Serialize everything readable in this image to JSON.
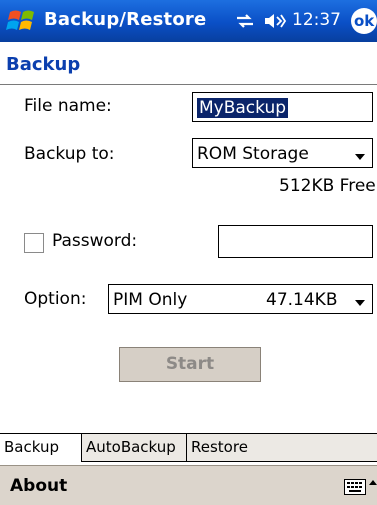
{
  "titlebar": {
    "app_title": "Backup/Restore",
    "clock": "12:37",
    "ok_label": "ok"
  },
  "section_heading": "Backup",
  "form": {
    "file_name_label": "File name:",
    "file_name_value": "MyBackup",
    "backup_to_label": "Backup to:",
    "backup_to_value": "ROM Storage",
    "free_space": "512KB Free",
    "password_label": "Password:",
    "password_value": "",
    "option_label": "Option:",
    "option_value": "PIM Only",
    "option_size": "47.14KB",
    "start_label": "Start"
  },
  "tabs": [
    {
      "label": "Backup",
      "active": true
    },
    {
      "label": "AutoBackup",
      "active": false
    },
    {
      "label": "Restore",
      "active": false
    }
  ],
  "menubar": {
    "about_label": "About"
  },
  "colors": {
    "title_blue": "#0a4fc6",
    "heading_blue": "#0b3fae",
    "menubar_bg": "#dcd5cc"
  }
}
